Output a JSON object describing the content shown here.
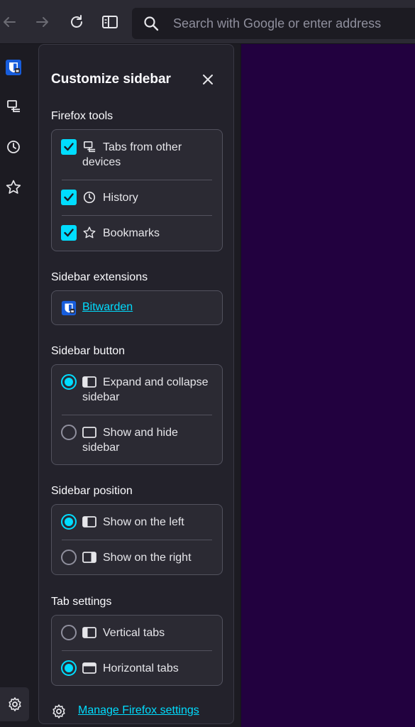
{
  "toolbar": {
    "search_placeholder": "Search with Google or enter address",
    "icons": [
      "back-icon",
      "forward-icon",
      "reload-icon",
      "sidebar-toggle-icon",
      "search-icon"
    ]
  },
  "launcher": {
    "items": [
      {
        "name": "bitwarden-icon"
      },
      {
        "name": "synced-tabs-icon"
      },
      {
        "name": "history-icon"
      },
      {
        "name": "bookmarks-icon"
      }
    ],
    "settings_icon": "gear-icon"
  },
  "panel": {
    "title": "Customize sidebar",
    "firefox_tools": {
      "heading": "Firefox tools",
      "items": [
        {
          "label": "Tabs from other devices",
          "checked": true,
          "icon": "synced-tabs-icon"
        },
        {
          "label": "History",
          "checked": true,
          "icon": "history-icon"
        },
        {
          "label": "Bookmarks",
          "checked": true,
          "icon": "bookmark-star-icon"
        }
      ]
    },
    "extensions": {
      "heading": "Sidebar extensions",
      "items": [
        {
          "label": "Bitwarden",
          "icon": "bitwarden-icon"
        }
      ]
    },
    "sidebar_button": {
      "heading": "Sidebar button",
      "options": [
        {
          "label": "Expand and collapse sidebar",
          "selected": true
        },
        {
          "label": "Show and hide sidebar",
          "selected": false
        }
      ]
    },
    "sidebar_position": {
      "heading": "Sidebar position",
      "options": [
        {
          "label": "Show on the left",
          "selected": true
        },
        {
          "label": "Show on the right",
          "selected": false
        }
      ]
    },
    "tab_settings": {
      "heading": "Tab settings",
      "options": [
        {
          "label": "Vertical tabs",
          "selected": false
        },
        {
          "label": "Horizontal tabs",
          "selected": true
        }
      ]
    },
    "footer_link": "Manage Firefox settings"
  },
  "colors": {
    "accent": "#00ddff",
    "content_bg": "#22013f",
    "panel_bg": "#23222b",
    "card_bg": "#2b2a33"
  }
}
